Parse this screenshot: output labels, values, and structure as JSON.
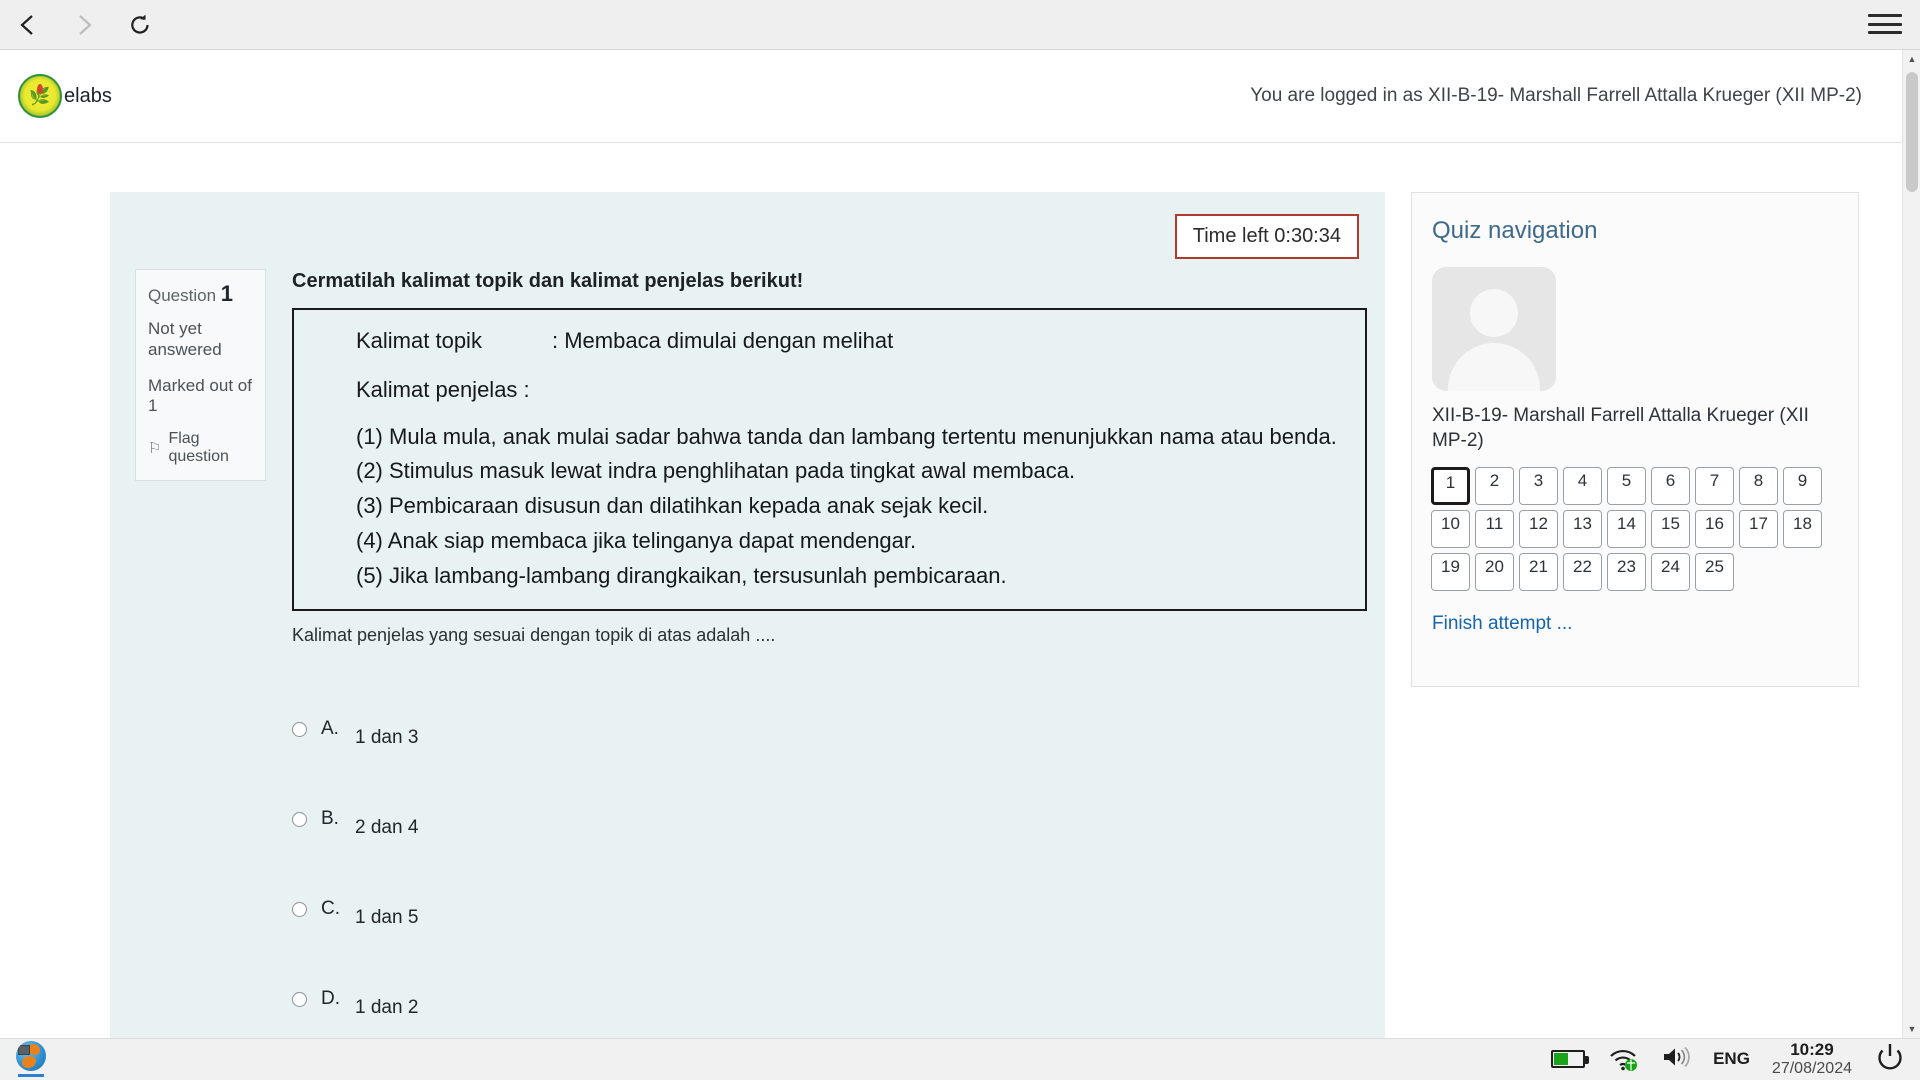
{
  "browser": {
    "back_icon": "chevron-left-icon",
    "forward_icon": "chevron-right-icon",
    "reload_icon": "reload-icon",
    "menu_icon": "hamburger-menu-icon"
  },
  "site_header": {
    "logo_icon": "school-crest-logo",
    "brand": "elabs",
    "login_status": "You are logged in as XII-B-19- Marshall Farrell Attalla Krueger (XII MP-2)"
  },
  "timer": {
    "label": "Time left 0:30:34",
    "border_color": "#b03a2e"
  },
  "question_info": {
    "question_word": "Question",
    "number": "1",
    "state": "Not yet answered",
    "marks": "Marked out of 1",
    "flag_icon": "flag-icon",
    "flag_label": "Flag question"
  },
  "question": {
    "prompt": "Cermatilah kalimat topik dan kalimat penjelas berikut!",
    "stimulus": {
      "topic_label": "Kalimat topik",
      "topic_value": ": Membaca dimulai dengan melihat",
      "explainer_label": "Kalimat penjelas :",
      "items": [
        "(1) Mula mula, anak mulai sadar bahwa tanda dan lambang tertentu menunjukkan nama atau benda.",
        "(2) Stimulus masuk lewat indra penghlihatan pada tingkat awal membaca.",
        "(3) Pembicaraan disusun dan dilatihkan kepada anak sejak kecil.",
        "(4) Anak siap membaca jika telinganya dapat mendengar.",
        "(5) Jika lambang-lambang dirangkaikan, tersusunlah pembicaraan."
      ]
    },
    "subtext": "Kalimat penjelas yang sesuai dengan topik di atas adalah ....",
    "answers": [
      {
        "letter": "A.",
        "text": "1 dan 3",
        "selected": false
      },
      {
        "letter": "B.",
        "text": "2 dan 4",
        "selected": false
      },
      {
        "letter": "C.",
        "text": "1 dan 5",
        "selected": false
      },
      {
        "letter": "D.",
        "text": "1 dan 2",
        "selected": false
      }
    ]
  },
  "quiz_navigation": {
    "title": "Quiz navigation",
    "avatar_icon": "user-avatar-placeholder",
    "user_name": "XII-B-19- Marshall Farrell Attalla Krueger (XII MP-2)",
    "questions": [
      {
        "n": "1",
        "current": true
      },
      {
        "n": "2",
        "current": false
      },
      {
        "n": "3",
        "current": false
      },
      {
        "n": "4",
        "current": false
      },
      {
        "n": "5",
        "current": false
      },
      {
        "n": "6",
        "current": false
      },
      {
        "n": "7",
        "current": false
      },
      {
        "n": "8",
        "current": false
      },
      {
        "n": "9",
        "current": false
      },
      {
        "n": "10",
        "current": false
      },
      {
        "n": "11",
        "current": false
      },
      {
        "n": "12",
        "current": false
      },
      {
        "n": "13",
        "current": false
      },
      {
        "n": "14",
        "current": false
      },
      {
        "n": "15",
        "current": false
      },
      {
        "n": "16",
        "current": false
      },
      {
        "n": "17",
        "current": false
      },
      {
        "n": "18",
        "current": false
      },
      {
        "n": "19",
        "current": false
      },
      {
        "n": "20",
        "current": false
      },
      {
        "n": "21",
        "current": false
      },
      {
        "n": "22",
        "current": false
      },
      {
        "n": "23",
        "current": false
      },
      {
        "n": "24",
        "current": false
      },
      {
        "n": "25",
        "current": false
      }
    ],
    "finish_link": "Finish attempt ..."
  },
  "taskbar": {
    "app_icon": "web-browser-globe-icon",
    "battery_icon": "battery-icon",
    "wifi_icon": "wifi-icon",
    "volume_icon": "speaker-icon",
    "language": "ENG",
    "time": "10:29",
    "date": "27/08/2024",
    "power_icon": "power-icon"
  }
}
